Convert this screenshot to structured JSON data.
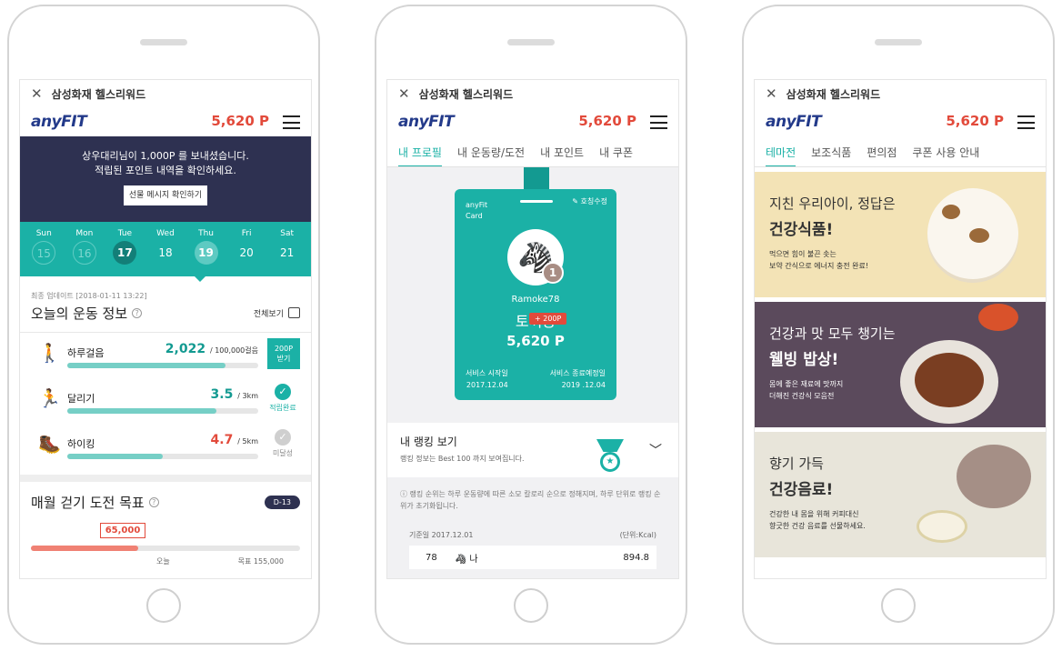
{
  "common": {
    "app_title": "삼성화재 헬스리워드",
    "logo": "anyFIT",
    "points": "5,620 P",
    "close_icon": "close-icon",
    "menu_icon": "hamburger-icon"
  },
  "phone1": {
    "banner_line1": "상우대리님이 1,000P 를 보내셨습니다.",
    "banner_line2": "적립된 포인트 내역을 확인하세요.",
    "banner_button": "선물 메시지 확인하기",
    "days": [
      {
        "dow": "Sun",
        "num": "15",
        "state": "past"
      },
      {
        "dow": "Mon",
        "num": "16",
        "state": "past"
      },
      {
        "dow": "Tue",
        "num": "17",
        "state": "done"
      },
      {
        "dow": "Wed",
        "num": "18",
        "state": "normal"
      },
      {
        "dow": "Thu",
        "num": "19",
        "state": "today"
      },
      {
        "dow": "Fri",
        "num": "20",
        "state": "normal"
      },
      {
        "dow": "Sat",
        "num": "21",
        "state": "normal"
      }
    ],
    "update_text": "최종 업데이트 [2018-01-11 13:22]",
    "today_title": "오늘의 운동 정보",
    "view_all": "전체보기",
    "activities": [
      {
        "name": "하루걸음",
        "value": "2,022",
        "unit": "/ 100,000걸음",
        "progress": 0.83,
        "color": "#139a91",
        "status": "200P\n받기"
      },
      {
        "name": "달리기",
        "value": "3.5",
        "unit": "/ 3km",
        "progress": 0.78,
        "color": "#139a91",
        "status": "적립완료"
      },
      {
        "name": "하이킹",
        "value": "4.7",
        "unit": "/ 5km",
        "progress": 0.5,
        "color": "#e24a3b",
        "status": "미달성"
      }
    ],
    "monthly_title": "매월 걷기 도전 목표",
    "dday": "D-13",
    "monthly_value": "65,000",
    "monthly_today": "오늘",
    "monthly_goal": "목표 155,000"
  },
  "phone2": {
    "tabs": [
      "내 프로필",
      "내 운동량/도전",
      "내 포인트",
      "내 쿠폰"
    ],
    "card_label_1": "anyFit",
    "card_label_2": "Card",
    "edit_label": "호칭수정",
    "rank_badge": "1",
    "username": "Ramoke78",
    "nickname": "토끼등",
    "plus_points": "+ 200P",
    "card_points": "5,620 P",
    "start_label": "서비스 시작일",
    "start_date": "2017.12.04",
    "end_label": "서비스 종료예정일",
    "end_date": "2019 .12.04",
    "ranking_title": "내 랭킹 보기",
    "ranking_sub": "랭킹 정보는 Best 100 까지 보여집니다.",
    "notice": "랭킹 순위는 하루 운동량에 따른 소모 칼로리 순으로 정해지며, 하루 단위로 랭킹 순위가 초기화됩니다.",
    "base_date": "기준일 2017.12.01",
    "unit": "(단위:Kcal)",
    "row_rank": "78",
    "row_name": "나",
    "row_value": "894.8"
  },
  "phone3": {
    "tabs": [
      "테마전",
      "보조식품",
      "편의점",
      "쿠폰 사용 안내"
    ],
    "features": [
      {
        "sub": "지친 우리아이, 정답은",
        "head": "건강식품!",
        "desc1": "먹으면 힘이 불끈 솟는",
        "desc2": "보약 간식으로 에너지 충전 완료!",
        "bg": "#f3e3b6",
        "fg": "#333"
      },
      {
        "sub": "건강과 맛 모두 챙기는",
        "head": "웰빙 밥상!",
        "desc1": "몸에 좋은 재료에 맛까지",
        "desc2": "더해진 건강식 모음전",
        "bg": "#5b4a5c",
        "fg": "#fff"
      },
      {
        "sub": "향기 가득",
        "head": "건강음료!",
        "desc1": "건강한 내 몸을 위해 커피대신",
        "desc2": "향긋한 건강 음료를 선물하세요.",
        "bg": "#e8e5da",
        "fg": "#333"
      }
    ]
  }
}
